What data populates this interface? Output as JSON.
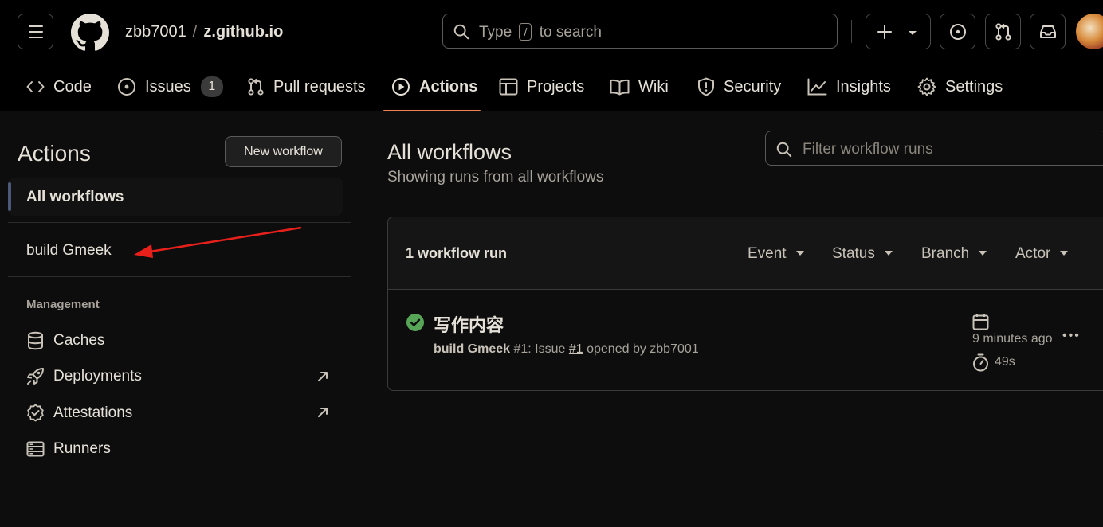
{
  "header": {
    "owner": "zbb7001",
    "separator": "/",
    "repo": "z.github.io",
    "search_before": "Type",
    "search_key": "/",
    "search_after": "to search"
  },
  "tabs": [
    {
      "label": "Code",
      "icon": "code-icon"
    },
    {
      "label": "Issues",
      "icon": "issue-opened-icon",
      "count": "1"
    },
    {
      "label": "Pull requests",
      "icon": "git-pull-request-icon"
    },
    {
      "label": "Actions",
      "icon": "play-icon",
      "active": true
    },
    {
      "label": "Projects",
      "icon": "table-icon"
    },
    {
      "label": "Wiki",
      "icon": "book-icon"
    },
    {
      "label": "Security",
      "icon": "shield-icon"
    },
    {
      "label": "Insights",
      "icon": "graph-icon"
    },
    {
      "label": "Settings",
      "icon": "gear-icon"
    }
  ],
  "sidebar": {
    "title": "Actions",
    "new_workflow": "New workflow",
    "all_workflows": "All workflows",
    "workflows": [
      {
        "label": "build Gmeek"
      }
    ],
    "management_label": "Management",
    "management": [
      {
        "label": "Caches",
        "icon": "database-icon"
      },
      {
        "label": "Deployments",
        "icon": "rocket-icon",
        "external": true
      },
      {
        "label": "Attestations",
        "icon": "verified-icon",
        "external": true
      },
      {
        "label": "Runners",
        "icon": "server-icon"
      }
    ]
  },
  "main": {
    "title": "All workflows",
    "subtitle": "Showing runs from all workflows",
    "filter_placeholder": "Filter workflow runs",
    "count_label": "1 workflow run",
    "facets": [
      "Event",
      "Status",
      "Branch",
      "Actor"
    ],
    "runs": [
      {
        "title": "写作内容",
        "workflow": "build Gmeek",
        "run_number": "#1",
        "trigger": ": Issue ",
        "issue_ref": "#1",
        "opened_by": " opened by zbb7001",
        "time_ago": "9 minutes ago",
        "duration": "49s",
        "status": "success"
      }
    ]
  },
  "colors": {
    "success": "#57a657",
    "annotation_arrow": "#e8201c",
    "active_tab_underline": "#f08058"
  }
}
